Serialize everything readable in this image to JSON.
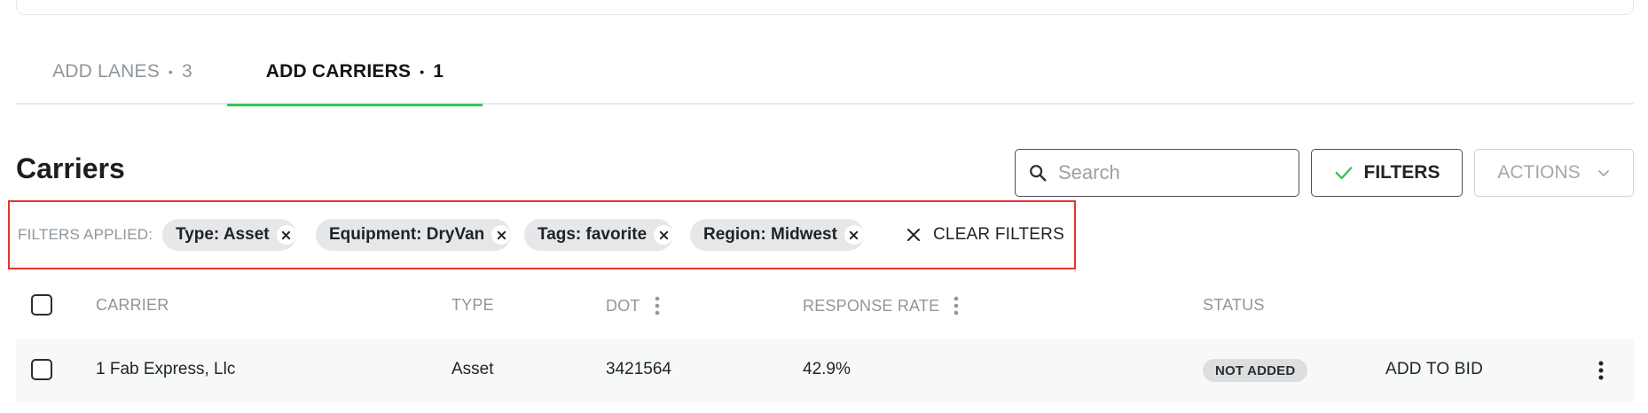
{
  "tabs": [
    {
      "label": "ADD LANES",
      "count": "3",
      "active": false
    },
    {
      "label": "ADD CARRIERS",
      "count": "1",
      "active": true
    }
  ],
  "tab_separator": "•",
  "section": {
    "title": "Carriers"
  },
  "search": {
    "placeholder": "Search",
    "value": ""
  },
  "toolbar": {
    "filters_label": "FILTERS",
    "actions_label": "ACTIONS"
  },
  "filters": {
    "label": "FILTERS APPLIED:",
    "chips": [
      "Type: Asset",
      "Equipment: DryVan",
      "Tags: favorite",
      "Region: Midwest"
    ],
    "clear_label": "CLEAR FILTERS"
  },
  "table": {
    "columns": [
      "CARRIER",
      "TYPE",
      "DOT",
      "RESPONSE RATE",
      "STATUS"
    ],
    "rows": [
      {
        "carrier": "1 Fab Express, Llc",
        "type": "Asset",
        "dot": "3421564",
        "response_rate": "42.9%",
        "status": "NOT ADDED",
        "action": "ADD TO BID"
      }
    ]
  },
  "icons": {
    "search": "search-icon",
    "filters": "check-icon",
    "actions": "chevron-down-icon",
    "chip_remove": "close-circle-icon",
    "clear": "close-icon",
    "column_menu": "kebab-vertical-icon",
    "row_menu": "kebab-vertical-icon"
  },
  "colors": {
    "accent": "#38c45c",
    "highlight_border": "#e5342a",
    "chip_bg": "#e6e7e8",
    "muted_text": "#8f969c"
  }
}
